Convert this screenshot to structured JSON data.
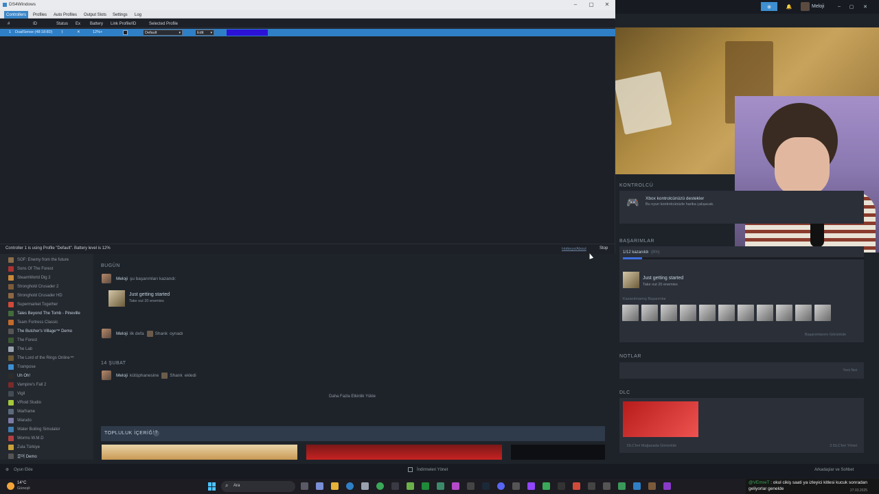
{
  "ds4": {
    "title": "DS4Windows",
    "tabs": [
      "Controllers",
      "Profiles",
      "Auto Profiles",
      "Output Slots",
      "Settings",
      "Log"
    ],
    "columns": [
      "#",
      "ID",
      "Status",
      "Ex",
      "Battery",
      "Link Profile/ID",
      "Selected Profile"
    ],
    "row": {
      "index": "1",
      "id": "DualSense (48:18:8D)",
      "battery": "12%+",
      "profile": "Default",
      "edit": "Edit"
    },
    "status_text": "Controller 1 is using Profile \"Default\". Battery level is 12%",
    "hotkeys_link": "Hotkeys/About",
    "stop_label": "Stop",
    "lightbar_color": "#2b12d6"
  },
  "steam": {
    "user": "Meloji",
    "sidebar_games": [
      "SOF: Enemy from the future",
      "Sons Of The Forest",
      "SteamWorld Dig 2",
      "Stronghold Crusader 2",
      "Stronghold Crusader HD",
      "Supermarket Together",
      "Tales Beyond The Tomb - Pineville",
      "Team Fortress Classic",
      "The Butcher's Village™ Demo",
      "The Forest",
      "The Lab",
      "The Lord of the Rings Online™",
      "Trampose",
      "Uh Oh!",
      "Vampire's Fall 2",
      "Vigil",
      "VRoid Studio",
      "Warframe",
      "Warudo",
      "Water Boiling Simulator",
      "Worms W.M.D",
      "Zula Türkiye",
      "끌어 Demo"
    ],
    "activity": {
      "today_label": "BUGÜN",
      "row1_text": "şu başarımları kazandı:",
      "ach_title": "Just getting started",
      "ach_desc": "Take out 20 enemies",
      "row2_a": "ilk defa",
      "row2_game": "Shank",
      "row2_b": "oynadı",
      "date2_label": "14 ŞUBAT",
      "row3_a": "kütüphanesine",
      "row3_game": "Shank",
      "row3_b": "ekledi",
      "load_more": "Daha Fazla Etkinlik Yükle"
    },
    "community_title": "TOPLULUK İÇERİĞİ",
    "right": {
      "controller_title": "KONTROLCÜ",
      "controller_line1": "Xbox kontrolcünüzü destekler",
      "controller_line2": "Bu oyun kontrolcünüzle harika çalışacak.",
      "ach_section": "BAŞARIMLAR",
      "ach_progress_text": "1/12 kazanıldı",
      "ach_progress_pct": "(8%)",
      "ach_progress_fraction": 0.08,
      "ach_title": "Just getting started",
      "ach_desc": "Take out 20 enemies",
      "locked_label": "Kazanılmamış Başarımlar",
      "view_ach": "Başarımlarımı Görüntüle",
      "notes_title": "NOTLAR",
      "new_note": "Yeni Not",
      "dlc_title": "DLC",
      "dlc_store": "DLC'leri Mağazada Görüntüle",
      "dlc_manage": "3 DLC'leri Yönet"
    },
    "footer_left": "Oyun Ekle",
    "footer_center": "İndirmeleri Yönet",
    "footer_right": "Arkadaşlar ve Sohbet"
  },
  "taskbar": {
    "weather_temp": "14°C",
    "weather_desc": "Güneşli",
    "search": "Ara",
    "chat_user": "@VEmreT",
    "chat_text": ": okul cikiş saati ya izleyici kitlesi kucuk sonradan geliyorlar geneldе",
    "date": "27.03.2025"
  }
}
